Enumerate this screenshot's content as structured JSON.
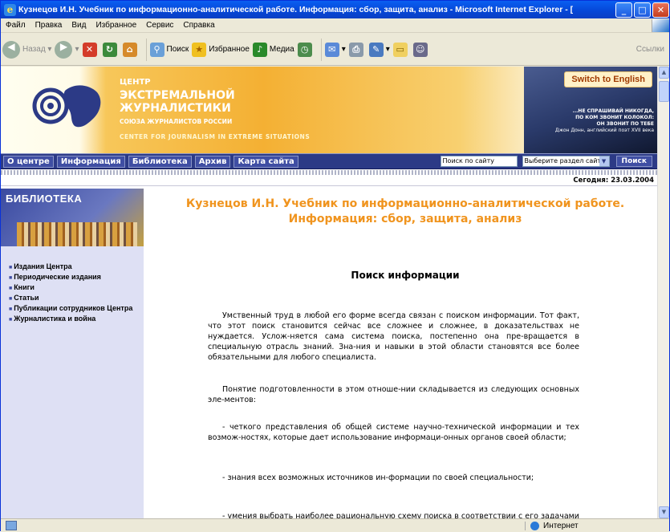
{
  "window": {
    "title": "Кузнецов И.Н. Учебник по информационно-аналитической работе. Информация: сбор, защита, анализ - Microsoft Internet Explorer - ["
  },
  "menu": [
    "Файл",
    "Правка",
    "Вид",
    "Избранное",
    "Сервис",
    "Справка"
  ],
  "toolbar": {
    "back": "Назад",
    "search": "Поиск",
    "favorites": "Избранное",
    "media": "Медиа",
    "links": "Ссылки"
  },
  "banner": {
    "org_lines": [
      "ЦЕНТР",
      "ЭКСТРЕМАЛЬНОЙ",
      "ЖУРНАЛИСТИКИ"
    ],
    "org_sub": "СОЮЗА ЖУРНАЛИСТОВ РОССИИ",
    "org_en": "CENTER FOR JOURNALISM IN EXTREME SITUATIONS",
    "switch": "Switch to English",
    "quote": [
      "...НЕ СПРАШИВАЙ НИКОГДА,",
      "ПО КОМ ЗВОНИТ КОЛОКОЛ:",
      "ОН ЗВОНИТ ПО ТЕБЕ",
      "Джон Донн, английский поэт XVII века"
    ]
  },
  "nav": {
    "items": [
      "О центре",
      "Информация",
      "Библиотека",
      "Архив",
      "Карта сайта"
    ],
    "search_value": "Поиск по сайту",
    "select_value": "Выберите раздел сайта",
    "search_button": "Поиск"
  },
  "date": "Сегодня: 23.03.2004",
  "sidebar": {
    "heading": "БИБЛИОТЕКА",
    "items": [
      "Издания Центра",
      "Периодические издания",
      "Книги",
      "Статьи",
      "Публикации сотрудников Центра",
      "Журналистика и война"
    ]
  },
  "content": {
    "title": "Кузнецов И.Н. Учебник по информационно-аналитической работе. Информация: сбор, защита, анализ",
    "section": "Поиск информации",
    "paragraphs": [
      "Умственный труд в любой его форме всегда связан с поиском информации. Тот факт, что этот поиск становится сейчас все сложнее и сложнее, в доказательствах не нуждается. Услож-няется сама система поиска, постепенно она пре-вращается в специальную отрасль знаний. Зна-ния и навыки в этой области становятся все более обязательными для любого специалиста.",
      "Понятие подготовленности в этом отноше-нии складывается из следующих основных эле-ментов:",
      "- четкого представления об общей системе научно-технической информации и тех возмож-ностях, которые дает использование информаци-онных органов своей области;",
      "- знания всех возможных источников ин-формации по своей специальности;",
      "- умения выбрать наиболее рациональную схему поиска в соответствии с его задачами и ус-ловиями;"
    ]
  },
  "status": {
    "zone": "Интернет"
  }
}
